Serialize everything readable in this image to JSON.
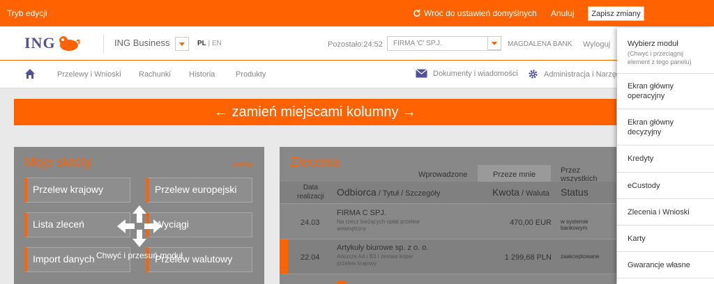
{
  "editbar": {
    "mode_label": "Tryb edycji",
    "restore_label": "Wróć do ustawień domyślnych",
    "cancel_label": "Anuluj",
    "save_label": "Zapisz zmiany"
  },
  "header": {
    "logo_text": "ING",
    "business_name": "ING Business",
    "lang_active": "PL",
    "lang_sep": " | ",
    "lang_other": "EN",
    "remaining": "Pozostało:24:52",
    "company": "FIRMA 'C' SP.J.",
    "user": "MAGDALENA BANK",
    "logout": "Wyloguj"
  },
  "nav": {
    "items": [
      "Przelewy i Wnioski",
      "Rachunki",
      "Historia",
      "Produkty"
    ],
    "documents": "Dokumenty i wiadomości",
    "admin": "Administracja i Narzędzia"
  },
  "swap_banner": "← zamień miejscami kolumny →",
  "shortcuts": {
    "title": "Moje skróty",
    "set_label": "Ustaw",
    "buttons": [
      "Przelew krajowy",
      "Przelew europejski",
      "Lista zleceń",
      "Wyciągi",
      "Import danych",
      "Przelew walutowy"
    ],
    "move_label": "Chwyć i przesuń moduł"
  },
  "orders": {
    "title": "Zlecenia",
    "tabs": [
      "Wprowadzone",
      "Przeze mnie",
      "Przez wszystkich"
    ],
    "columns": {
      "date_line1": "Data",
      "date_line2": "realizacji",
      "party": "Odbiorca",
      "party_sub": " / Tytuł / Szczegóły",
      "amount": "Kwota",
      "amount_sub": " / Waluta",
      "status": "Status"
    },
    "rows": [
      {
        "date": "24.03",
        "party": "FIRMA C SPJ.",
        "desc": "Na rzecz bieżących opłat przelew wewnętrzny",
        "amount": "470,00 EUR",
        "status": "w systemie bankowym"
      },
      {
        "date": "22.04",
        "party": "Artykuły biurowe sp. z o. o.",
        "desc": "Arkusze A4 i B3 i zestaw koper przelew krajowy",
        "amount": "1 299,68 PLN",
        "status": "zaakceptowane"
      }
    ]
  },
  "picker": {
    "title": "Wybierz moduł",
    "hint": "(Chwyć i przeciągnij element z tego panelu)",
    "items": [
      "Ekran główny operacyjny",
      "Ekran główny decyzyjny",
      "Kredyty",
      "eCustody",
      "Zlecenia i Wnioski",
      "Karty",
      "Gwarancje własne"
    ]
  },
  "colors": {
    "accent": "#ff6200",
    "brand_blue": "#525199"
  }
}
